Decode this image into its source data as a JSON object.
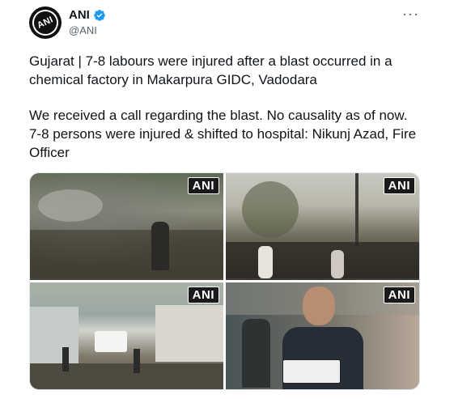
{
  "tweet": {
    "display_name": "ANI",
    "handle": "@ANI",
    "avatar_text": "ANI",
    "more_glyph": "···",
    "paragraph_1": "Gujarat | 7-8 labours were injured after a blast occurred in a chemical factory in Makarpura GIDC, Vadodara",
    "paragraph_2": "We received a call regarding the blast. No causality as of now. 7-8 persons were injured & shifted to hospital: Nikunj Azad, Fire Officer",
    "photos": [
      {
        "watermark": "ANI"
      },
      {
        "watermark": "ANI"
      },
      {
        "watermark": "ANI"
      },
      {
        "watermark": "ANI"
      }
    ]
  },
  "colors": {
    "verified_blue": "#1d9bf0",
    "handle_gray": "#536471"
  },
  "icons": {
    "verified": "verified-badge-icon",
    "more": "more-options-icon"
  }
}
